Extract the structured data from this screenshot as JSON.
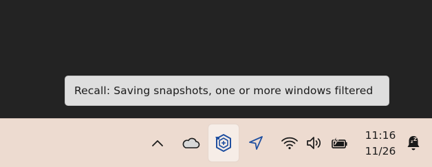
{
  "tooltip": {
    "text": "Recall: Saving snapshots, one or more windows filtered"
  },
  "tray": {
    "icons": [
      "chevron-up-icon",
      "onedrive-cloud-icon",
      "recall-icon",
      "location-icon",
      "wifi-icon",
      "volume-icon",
      "battery-charging-icon",
      "notification-bell-snooze-icon"
    ],
    "colors": {
      "taskbar": "#eddbd0",
      "desktop": "#232323",
      "accent": "#1f4fa0"
    }
  },
  "clock": {
    "time": "11:16",
    "date": "11/26"
  }
}
